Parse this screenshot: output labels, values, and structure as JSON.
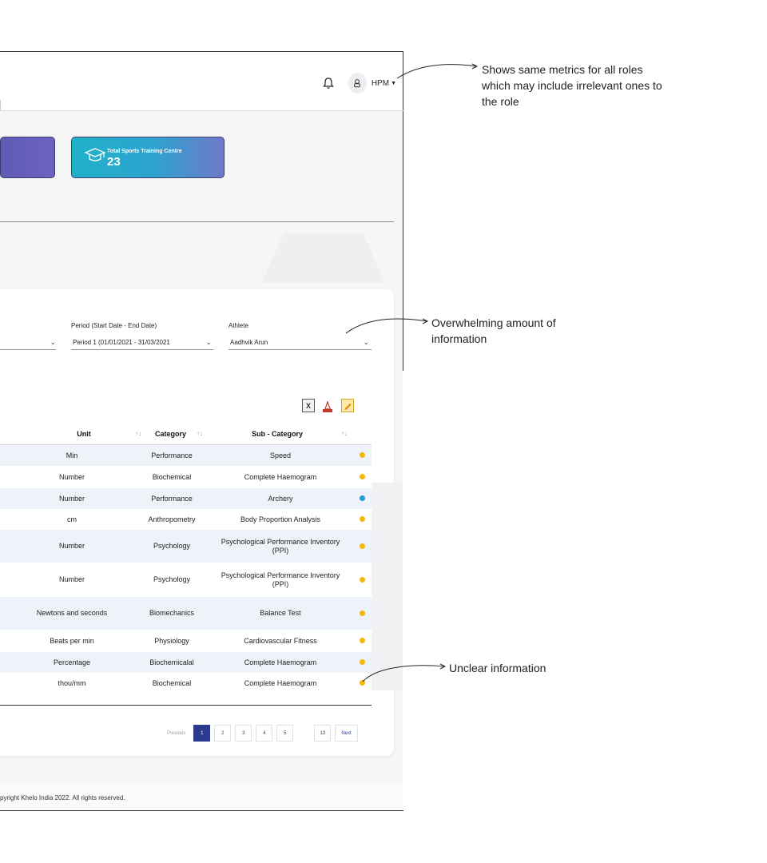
{
  "header": {
    "user_name": "HPM"
  },
  "metrics": {
    "sports_training_centre_label": "Total Sports Training Centre",
    "sports_training_centre_value": "23"
  },
  "filters": {
    "period_label": "Period (Start Date - End Date)",
    "period_value": "Period 1 (01/01/2021 - 31/03/2021",
    "athlete_label": "Athlete",
    "athlete_value": "Aadhvik Arun"
  },
  "table": {
    "columns": {
      "unit": "Unit",
      "category": "Category",
      "sub_category": "Sub - Category"
    },
    "rows": [
      {
        "unit": "Min",
        "category": "Performance",
        "sub_category": "Speed",
        "status_color": "#f5b70f"
      },
      {
        "unit": "Number",
        "category": "Biochemical",
        "sub_category": "Complete Haemogram",
        "status_color": "#f5b70f"
      },
      {
        "unit": "Number",
        "category": "Performance",
        "sub_category": "Archery",
        "status_color": "#2d9bd6"
      },
      {
        "unit": "cm",
        "category": "Anthropometry",
        "sub_category": "Body Proportion Analysis",
        "status_color": "#f5b70f"
      },
      {
        "unit": "Number",
        "category": "Psychology",
        "sub_category": "Psychological Performance Inventory (PPI)",
        "status_color": "#f5b70f"
      },
      {
        "unit": "Number",
        "category": "Psychology",
        "sub_category": "Psychological Performance Inventory (PPI)",
        "status_color": "#f5b70f"
      },
      {
        "unit": "Newtons and seconds",
        "category": "Biomechanics",
        "sub_category": "Balance Test",
        "status_color": "#f5b70f"
      },
      {
        "unit": "Beats per min",
        "category": "Physiology",
        "sub_category": "Cardiovascular Fitness",
        "status_color": "#f5b70f"
      },
      {
        "unit": "Percentage",
        "category": "Biochemicalal",
        "sub_category": "Complete Haemogram",
        "status_color": "#f5b70f"
      },
      {
        "unit": "thou/mm",
        "category": "Biochemical",
        "sub_category": "Complete Haemogram",
        "status_color": "#f5b70f"
      }
    ]
  },
  "pagination": {
    "previous": "Previous",
    "pages": [
      "1",
      "2",
      "3",
      "4",
      "5"
    ],
    "last_page": "13",
    "next": "Next"
  },
  "footer": {
    "copyright": "pyright Khelo India 2022. All rights reserved."
  },
  "annotations": {
    "roles_note": "Shows same metrics for all roles which may include irrelevant ones to the role",
    "info_note": "Overwhelming amount of information",
    "unclear_note": "Unclear information"
  },
  "colors": {
    "accent": "#2b3a8f",
    "status_yellow": "#f5b70f",
    "status_blue": "#2d9bd6"
  }
}
